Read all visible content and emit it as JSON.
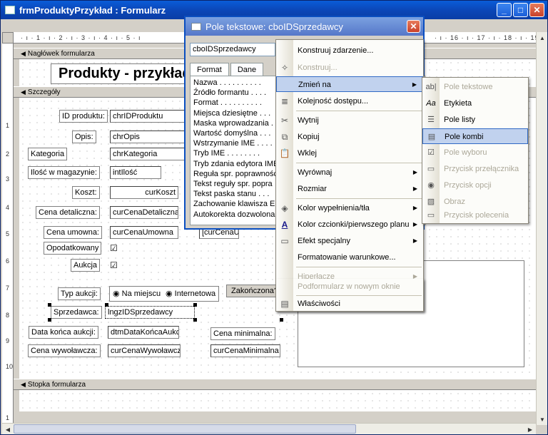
{
  "window": {
    "title": "frmProduktyPrzykład : Formularz"
  },
  "ruler": {
    "h_left": "· ı · 1 · ı · 2 · ı · 3 · ı · 4 · ı · 5 · ı",
    "h_right": "· ı · 16 · ı · 17 · ı · 18 · ı · 19 ·",
    "v": [
      "1",
      "2",
      "3",
      "4",
      "5",
      "6",
      "7",
      "8",
      "9",
      "10",
      "1"
    ]
  },
  "sections": {
    "header": "Nagłówek formularza",
    "details": "Szczegóły",
    "footer": "Stopka formularza"
  },
  "form": {
    "title": "Produkty - przykład",
    "fields": [
      {
        "label": "ID produktu:",
        "value": "chrIDProduktu"
      },
      {
        "label": "Opis:",
        "value": "chrOpis"
      },
      {
        "label": "Kategoria",
        "value": "chrKategoria"
      },
      {
        "label": "Ilość w magazynie:",
        "value": "intIlość"
      },
      {
        "label": "Koszt:",
        "value": "curKoszt"
      },
      {
        "label": "Cena detaliczna:",
        "value": "curCenaDetaliczna"
      },
      {
        "label": "Cena umowna:",
        "value": "curCenaUmowna"
      },
      {
        "label": "Opodatkowany",
        "value": "☑"
      },
      {
        "label": "Aukcja",
        "value": "☑"
      },
      {
        "label": "Typ aukcji:",
        "value": ""
      },
      {
        "label": "Sprzedawca:",
        "value": "lngzIDSprzedawcy"
      },
      {
        "label": "Data końca aukcji:",
        "value": "dtmDataKońcaAukcji"
      },
      {
        "label": "Cena wywoławcza:",
        "value": "curCenaWywoławcz."
      }
    ],
    "auction_options": [
      "Na miejscu",
      "Internetowa"
    ],
    "finished_button": "Zakończona?",
    "min_price_label": "Cena minimalna:",
    "min_price_value": "curCenaMinimalna",
    "partial_field": "[curCenaUmowna]"
  },
  "properties": {
    "title": "Pole tekstowe: cboIDSprzedawcy",
    "combo_value": "cboIDSprzedawcy",
    "tabs": [
      "Format",
      "Dane"
    ],
    "rows": [
      "Nazwa . . . . . . . . . .",
      "Źródło formantu . . . .",
      "Format . . . . . . . . . .",
      "Miejsca dziesiętne . . .",
      "Maska wprowadzania . .",
      "Wartość domyślna . . .",
      "Wstrzymanie IME . . . .",
      "Tryb IME . . . . . . . .",
      "Tryb zdania edytora IME",
      "Reguła spr. poprawności",
      "Tekst reguły spr. popra",
      "Tekst paska stanu . . .",
      "Zachowanie klawisza EN",
      "Autokorekta dozwolona"
    ]
  },
  "context_menu": [
    {
      "label": "Konstruuj zdarzenie...",
      "icon": "",
      "disabled": false,
      "submenu": false
    },
    {
      "label": "Konstruuj...",
      "icon": "✧",
      "disabled": true,
      "submenu": false
    },
    {
      "label": "Zmień na",
      "icon": "",
      "disabled": false,
      "submenu": true,
      "highlighted": true
    },
    {
      "label": "Kolejność dostępu...",
      "icon": "≣",
      "disabled": false,
      "submenu": false
    },
    {
      "label": "Wytnij",
      "icon": "✂",
      "disabled": false,
      "submenu": false
    },
    {
      "label": "Kopiuj",
      "icon": "⧉",
      "disabled": false,
      "submenu": false
    },
    {
      "label": "Wklej",
      "icon": "📋",
      "disabled": false,
      "submenu": false
    },
    {
      "label": "Wyrównaj",
      "icon": "",
      "disabled": false,
      "submenu": true
    },
    {
      "label": "Rozmiar",
      "icon": "",
      "disabled": false,
      "submenu": true
    },
    {
      "label": "Kolor wypełnienia/tła",
      "icon": "◈",
      "disabled": false,
      "submenu": true
    },
    {
      "label": "Kolor czcionki/pierwszego planu",
      "icon": "A",
      "disabled": false,
      "submenu": true
    },
    {
      "label": "Efekt specjalny",
      "icon": "▭",
      "disabled": false,
      "submenu": true
    },
    {
      "label": "Formatowanie warunkowe...",
      "icon": "",
      "disabled": false,
      "submenu": false
    },
    {
      "label": "Hiperłącze",
      "icon": "",
      "disabled": true,
      "submenu": true
    },
    {
      "label": "Podformularz w nowym oknie",
      "icon": "",
      "disabled": true,
      "submenu": false
    },
    {
      "label": "Właściwości",
      "icon": "▤",
      "disabled": false,
      "submenu": false
    }
  ],
  "submenu": [
    {
      "label": "Pole tekstowe",
      "icon": "ab|",
      "disabled": true
    },
    {
      "label": "Etykieta",
      "icon": "Aa",
      "disabled": false
    },
    {
      "label": "Pole listy",
      "icon": "☰",
      "disabled": false
    },
    {
      "label": "Pole kombi",
      "icon": "▤",
      "disabled": false,
      "highlighted": true
    },
    {
      "label": "Pole wyboru",
      "icon": "☑",
      "disabled": true
    },
    {
      "label": "Przycisk przełącznika",
      "icon": "▭",
      "disabled": true
    },
    {
      "label": "Przycisk opcji",
      "icon": "◉",
      "disabled": true
    },
    {
      "label": "Obraz",
      "icon": "▧",
      "disabled": true
    },
    {
      "label": "Przycisk polecenia",
      "icon": "▭",
      "disabled": true
    }
  ],
  "colors": {
    "titlebar": "#0b47b8",
    "highlight": "#c1d2ee",
    "highlight_border": "#316ac5"
  }
}
